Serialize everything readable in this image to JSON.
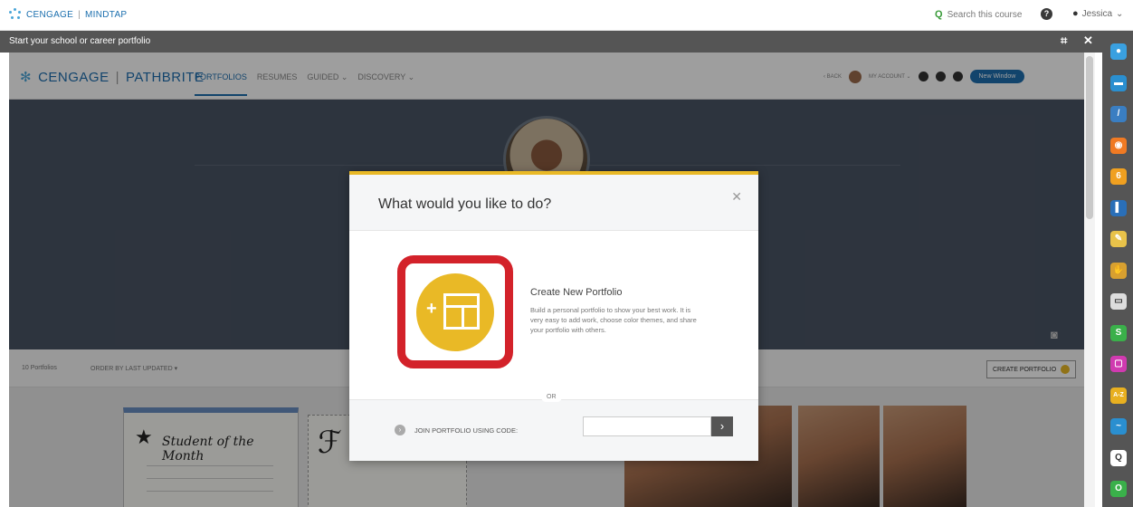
{
  "mindtap": {
    "brand_left": "CENGAGE",
    "brand_right": "MINDTAP",
    "search_placeholder": "Search this course",
    "help": "?",
    "user_name": "Jessica"
  },
  "activity": {
    "title": "Start your school or career portfolio"
  },
  "pathbrite": {
    "brand_left": "CENGAGE",
    "brand_right": "PATHBRITE",
    "nav": [
      "PORTFOLIOS",
      "RESUMES",
      "GUIDED ⌄",
      "DISCOVERY ⌄"
    ],
    "back": "‹ BACK",
    "my_account": "MY ACCOUNT ⌄",
    "new_window": "New Window",
    "portfolio_count": "10 Portfolios",
    "sort": "ORDER BY LAST UPDATED ▾",
    "create_portfolio": "CREATE PORTFOLIO",
    "cert_title": "Student of the Month"
  },
  "modal": {
    "title": "What would you like to do?",
    "option_title": "Create New Portfolio",
    "option_desc": "Build a personal portfolio to show your best work. It is very easy to add work, choose color themes, and share your portfolio with others.",
    "or": "OR",
    "join_label": "JOIN PORTFOLIO USING CODE:",
    "go": "›"
  },
  "dock_apps": [
    {
      "name": "google-app",
      "color": "#3aa0e0",
      "glyph": "●"
    },
    {
      "name": "briefcase-app",
      "color": "#2a8fd0",
      "glyph": "▬"
    },
    {
      "name": "highlighter-app",
      "color": "#3a7ec2",
      "glyph": "/"
    },
    {
      "name": "rss-app",
      "color": "#f07a23",
      "glyph": "◉"
    },
    {
      "name": "aplia-app",
      "color": "#f0a020",
      "glyph": "6"
    },
    {
      "name": "book-app",
      "color": "#2a6fb8",
      "glyph": "▌"
    },
    {
      "name": "notes-app",
      "color": "#e8c24a",
      "glyph": "✎"
    },
    {
      "name": "hand-app",
      "color": "#d8a030",
      "glyph": "✋"
    },
    {
      "name": "chat-app",
      "color": "#ddd",
      "glyph": "▭"
    },
    {
      "name": "s-app",
      "color": "#3ab04a",
      "glyph": "S"
    },
    {
      "name": "screen-app",
      "color": "#d03ab0",
      "glyph": "▢"
    },
    {
      "name": "az-app",
      "color": "#e8b020",
      "glyph": "A-Z"
    },
    {
      "name": "chart-app",
      "color": "#2a8fd0",
      "glyph": "~"
    },
    {
      "name": "search-app",
      "color": "#ffffff",
      "glyph": "Q"
    },
    {
      "name": "o-app",
      "color": "#3ab04a",
      "glyph": "O"
    }
  ]
}
